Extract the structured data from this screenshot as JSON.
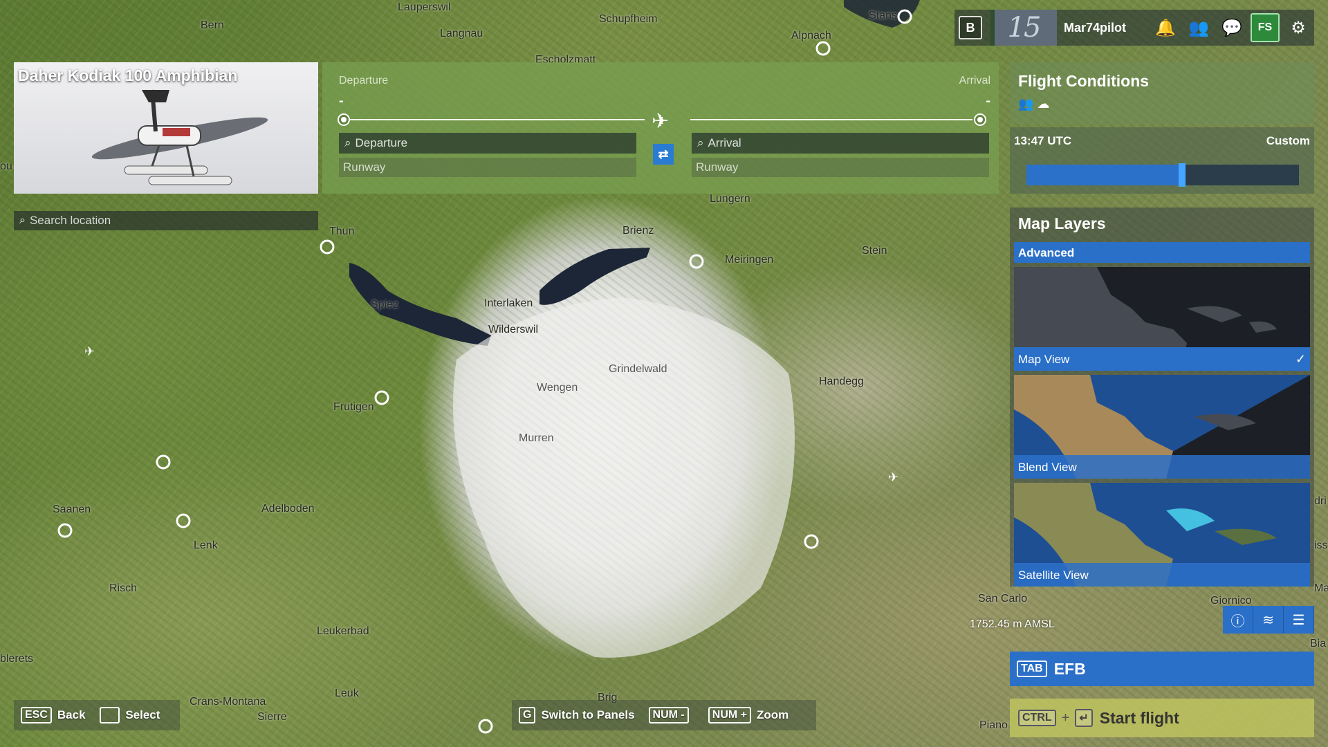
{
  "topbar": {
    "b_key": "B",
    "anniversary_badge": "15",
    "username": "Mar74pilot",
    "store_label": "FS"
  },
  "aircraft": {
    "name": "Daher Kodiak 100 Amphibian"
  },
  "search": {
    "placeholder": "Search location"
  },
  "route": {
    "departure_label": "Departure",
    "arrival_label": "Arrival",
    "departure_dash": "-",
    "arrival_dash": "-",
    "departure_placeholder": "Departure",
    "arrival_placeholder": "Arrival",
    "departure_runway": "Runway",
    "arrival_runway": "Runway"
  },
  "flight_conditions": {
    "title": "Flight Conditions",
    "time": "13:47 UTC",
    "mode": "Custom",
    "time_of_day_fraction": 0.57
  },
  "map_layers": {
    "title": "Map Layers",
    "tab": "Advanced",
    "items": [
      {
        "label": "Map View",
        "selected": true
      },
      {
        "label": "Blend View",
        "selected": false
      },
      {
        "label": "Satellite View",
        "selected": false
      }
    ]
  },
  "altitude": "1752.45 m AMSL",
  "efb": {
    "key": "TAB",
    "label": "EFB"
  },
  "start_flight": {
    "key": "CTRL",
    "plus": "+",
    "label": "Start flight"
  },
  "hints": {
    "back_key": "ESC",
    "back_label": "Back",
    "select_label": "Select",
    "switch_key": "G",
    "switch_label": "Switch to Panels",
    "zoom_out_key": "NUM -",
    "zoom_in_key": "NUM +",
    "zoom_label": "Zoom"
  },
  "places": [
    "Bern",
    "Lauperswil",
    "Schupfheim",
    "Stans",
    "Langnau",
    "Alpnach",
    "Escholzmatt",
    "Thun",
    "Brienz",
    "Lungern",
    "Meiringen",
    "Stein",
    "Spiez",
    "Interlaken",
    "Wilderswil",
    "Grindelwald",
    "Wengen",
    "Handegg",
    "Murren",
    "Frutigen",
    "Saanen",
    "Adelboden",
    "Lenk",
    "Risch",
    "Leukerbad",
    "Crans-Montana",
    "Sierre",
    "Leuk",
    "Brig",
    "San Carlo",
    "Giornico",
    "Bia",
    "Mal",
    "Piano",
    "dri",
    "iss",
    "blerets",
    "ou"
  ],
  "colors": {
    "accent_blue": "#2b70c8",
    "route_green": "#78a050",
    "start_yellow": "#bec35f"
  },
  "icons": [
    "bell-icon",
    "friends-icon",
    "chat-icon",
    "store-icon",
    "gear-icon",
    "search-icon",
    "plane-icon",
    "swap-icon",
    "weather-icon",
    "info-icon",
    "layers-icon",
    "settings-list-icon",
    "airport-marker-icon"
  ]
}
